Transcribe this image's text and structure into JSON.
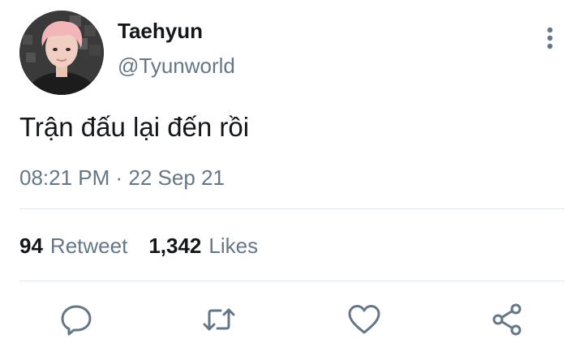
{
  "user": {
    "display_name": "Taehyun",
    "handle": "@Tyunworld",
    "avatar_icon": "profile-photo"
  },
  "tweet": {
    "text": "Trận đấu lại đến rồi",
    "timestamp": "08:21 PM · 22 Sep 21"
  },
  "stats": {
    "retweet_count": "94",
    "retweet_label": "Retweet",
    "likes_count": "1,342",
    "likes_label": "Likes"
  },
  "actions": [
    {
      "icon": "reply-icon"
    },
    {
      "icon": "retweet-icon"
    },
    {
      "icon": "like-icon"
    },
    {
      "icon": "share-icon"
    }
  ],
  "colors": {
    "text_primary": "#14171a",
    "text_secondary": "#657786",
    "divider": "#e1e8ed",
    "icon": "#657786"
  }
}
